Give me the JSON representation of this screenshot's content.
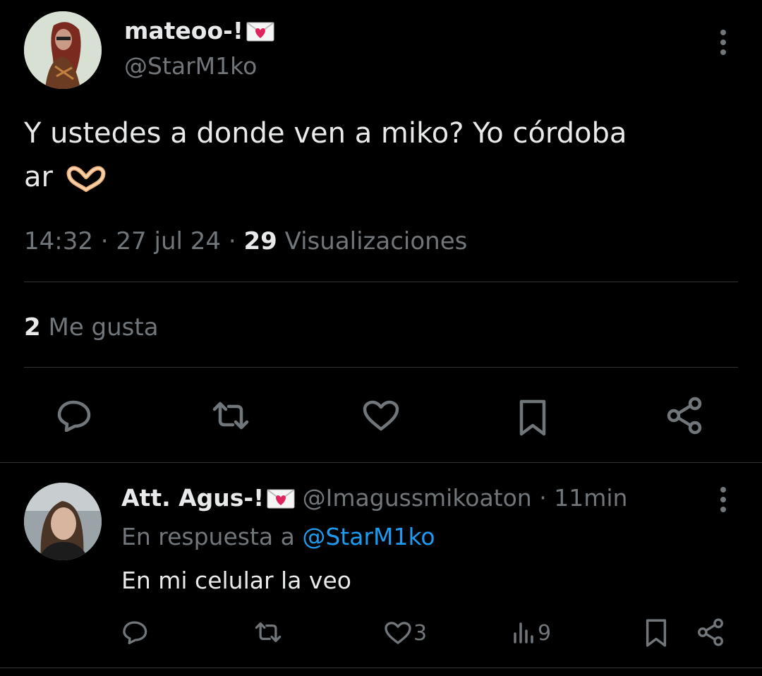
{
  "main_tweet": {
    "display_name": "mateoo-!",
    "handle": "@StarM1ko",
    "text_line1": "Y ustedes a donde ven a miko? Yo córdoba",
    "text_line2": "ar",
    "time": "14:32",
    "date": "27 jul 24",
    "views_count": "29",
    "views_label": "Visualizaciones",
    "likes_count": "2",
    "likes_label": "Me gusta",
    "sep": "·"
  },
  "reply": {
    "display_name": "Att. Agus-!",
    "handle": "@Imagussmikoaton",
    "time": "11min",
    "reply_prefix": "En respuesta a",
    "reply_to": "@StarM1ko",
    "text": "En mi celular la veo",
    "likes": "3",
    "views": "9",
    "sep": "·"
  },
  "colors": {
    "background": "#000000",
    "text": "#e7e9ea",
    "muted": "#71767b",
    "link": "#1d9bf0",
    "divider": "#2f3336",
    "envelope_heart": "#e0245e"
  },
  "icons": [
    "more-icon",
    "reply-icon",
    "retweet-icon",
    "like-icon",
    "bookmark-icon",
    "share-icon",
    "views-icon",
    "envelope-heart-icon",
    "heart-hands-icon"
  ]
}
